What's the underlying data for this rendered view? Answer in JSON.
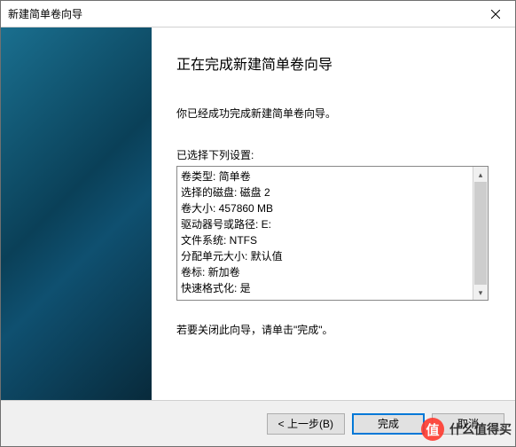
{
  "window": {
    "title": "新建简单卷向导"
  },
  "content": {
    "headline": "正在完成新建简单卷向导",
    "success_text": "你已经成功完成新建简单卷向导。",
    "settings_label": "已选择下列设置:",
    "settings": [
      "卷类型: 简单卷",
      "选择的磁盘: 磁盘 2",
      "卷大小: 457860 MB",
      "驱动器号或路径: E:",
      "文件系统: NTFS",
      "分配单元大小: 默认值",
      "卷标: 新加卷",
      "快速格式化: 是"
    ],
    "close_hint": "若要关闭此向导，请单击\"完成\"。"
  },
  "buttons": {
    "back": "< 上一步(B)",
    "finish": "完成",
    "cancel": "取消"
  },
  "watermark": {
    "glyph": "值",
    "text": "什么值得买"
  }
}
